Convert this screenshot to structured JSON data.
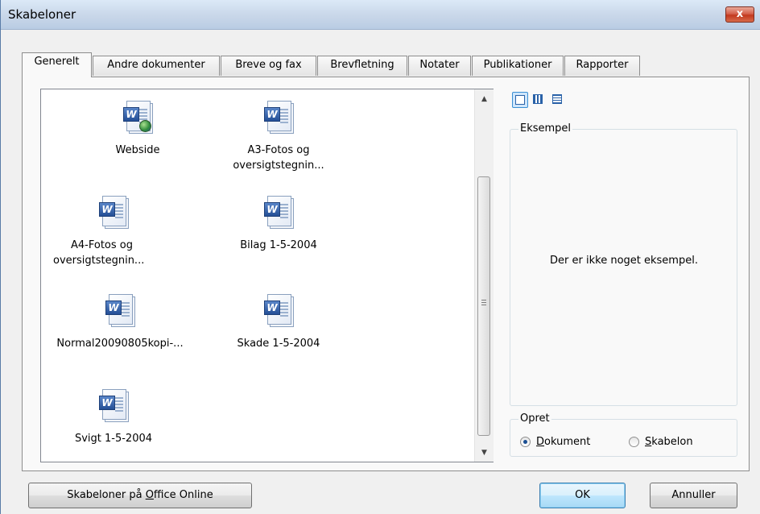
{
  "window": {
    "title": "Skabeloner",
    "close_label": "x"
  },
  "tabs": [
    {
      "label": "Generelt",
      "active": true
    },
    {
      "label": "Andre dokumenter",
      "active": false
    },
    {
      "label": "Breve og fax",
      "active": false
    },
    {
      "label": "Brevfletning",
      "active": false
    },
    {
      "label": "Notater",
      "active": false
    },
    {
      "label": "Publikationer",
      "active": false
    },
    {
      "label": "Rapporter",
      "active": false
    }
  ],
  "templates": [
    {
      "line1": "Webside",
      "line2": "",
      "icon": "word-web-page-icon"
    },
    {
      "line1": "A3-Fotos og",
      "line2": "oversigtstegnin...",
      "icon": "word-document-icon"
    },
    {
      "line1": "A4-Fotos og",
      "line2": "oversigtstegnin...",
      "icon": "word-document-icon"
    },
    {
      "line1": "Bilag 1-5-2004",
      "line2": "",
      "icon": "word-document-icon"
    },
    {
      "line1": "Normal20090805kopi-...",
      "line2": "",
      "icon": "word-document-icon"
    },
    {
      "line1": "Skade 1-5-2004",
      "line2": "",
      "icon": "word-document-icon"
    },
    {
      "line1": "Svigt 1-5-2004",
      "line2": "",
      "icon": "word-document-icon"
    }
  ],
  "preview": {
    "legend": "Eksempel",
    "message": "Der er ikke noget eksempel."
  },
  "create": {
    "legend": "Opret",
    "document_label_prefix": "",
    "document_label_accel": "D",
    "document_label_rest": "okument",
    "template_label_accel": "S",
    "template_label_rest": "kabelon",
    "selected": "Dokument"
  },
  "buttons": {
    "online_prefix": "Skabeloner på ",
    "online_accel": "O",
    "online_rest": "ffice Online",
    "ok": "OK",
    "cancel": "Annuller"
  },
  "colors": {
    "accent": "#3c7fb1",
    "close": "#c2391f"
  }
}
